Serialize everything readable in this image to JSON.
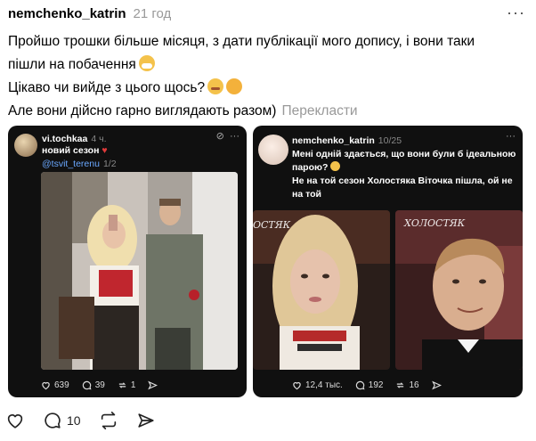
{
  "post": {
    "username": "nemchenko_katrin",
    "time": "21 год",
    "line1": "Пройшо трошки більше місяця, з дати публікації мого допису, і вони таки",
    "line2": "пішли на побачення",
    "line3": "Цікаво чи вийде з цього щось?",
    "line4": "Але вони дійсно гарно виглядають разом)",
    "translate": "Перекласти",
    "more": "···"
  },
  "card1": {
    "username": "vi.tochkaa",
    "time": "4 ч.",
    "text": "новий сезон",
    "mention": "@tsvit_terenu",
    "pager": "1/2",
    "likes": "639",
    "comments": "39",
    "reposts": "1"
  },
  "card2": {
    "username": "nemchenko_katrin",
    "pager": "10/25",
    "text1": "Мені одній здається, що вони були б ідеальною",
    "text2": "парою?",
    "text3": "Не на той сезон Холостяка Віточка пішла, ой не",
    "text4": "на той",
    "likes": "12,4 тыс.",
    "comments": "192",
    "reposts": "16",
    "overlay_left": "ОСТЯК",
    "overlay_right": "ХОЛОСТЯК"
  },
  "actions": {
    "comments": "10"
  },
  "colors": {
    "muted": "#999999",
    "card_bg": "#101010",
    "mention": "#6aa8ff"
  }
}
